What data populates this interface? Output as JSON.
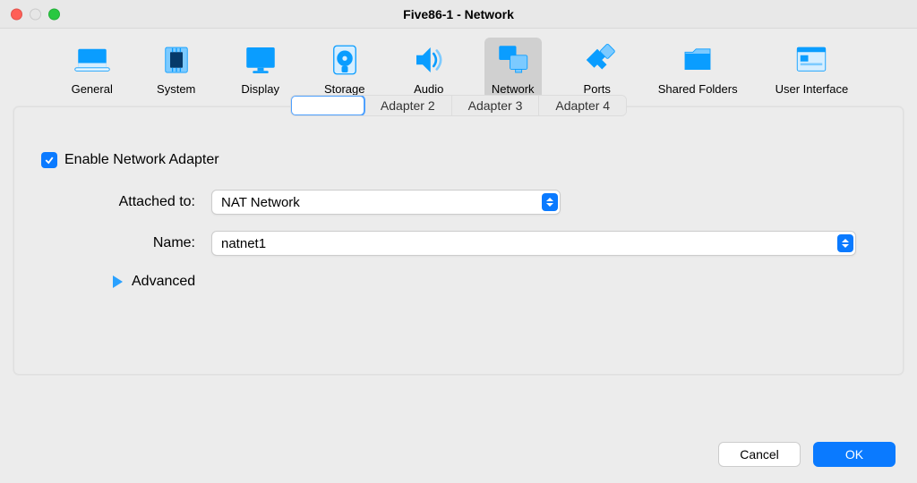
{
  "window": {
    "title": "Five86-1 - Network"
  },
  "toolbar": {
    "items": [
      {
        "label": "General"
      },
      {
        "label": "System"
      },
      {
        "label": "Display"
      },
      {
        "label": "Storage"
      },
      {
        "label": "Audio"
      },
      {
        "label": "Network"
      },
      {
        "label": "Ports"
      },
      {
        "label": "Shared Folders"
      },
      {
        "label": "User Interface"
      }
    ],
    "active_index": 5
  },
  "adapter_tabs": {
    "items": [
      {
        "label": ""
      },
      {
        "label": "Adapter 2"
      },
      {
        "label": "Adapter 3"
      },
      {
        "label": "Adapter 4"
      }
    ],
    "active_index": 0
  },
  "form": {
    "enable_label": "Enable Network Adapter",
    "enable_checked": true,
    "attached_label": "Attached to:",
    "attached_value": "NAT Network",
    "name_label": "Name:",
    "name_value": "natnet1",
    "advanced_label": "Advanced"
  },
  "buttons": {
    "cancel": "Cancel",
    "ok": "OK"
  }
}
